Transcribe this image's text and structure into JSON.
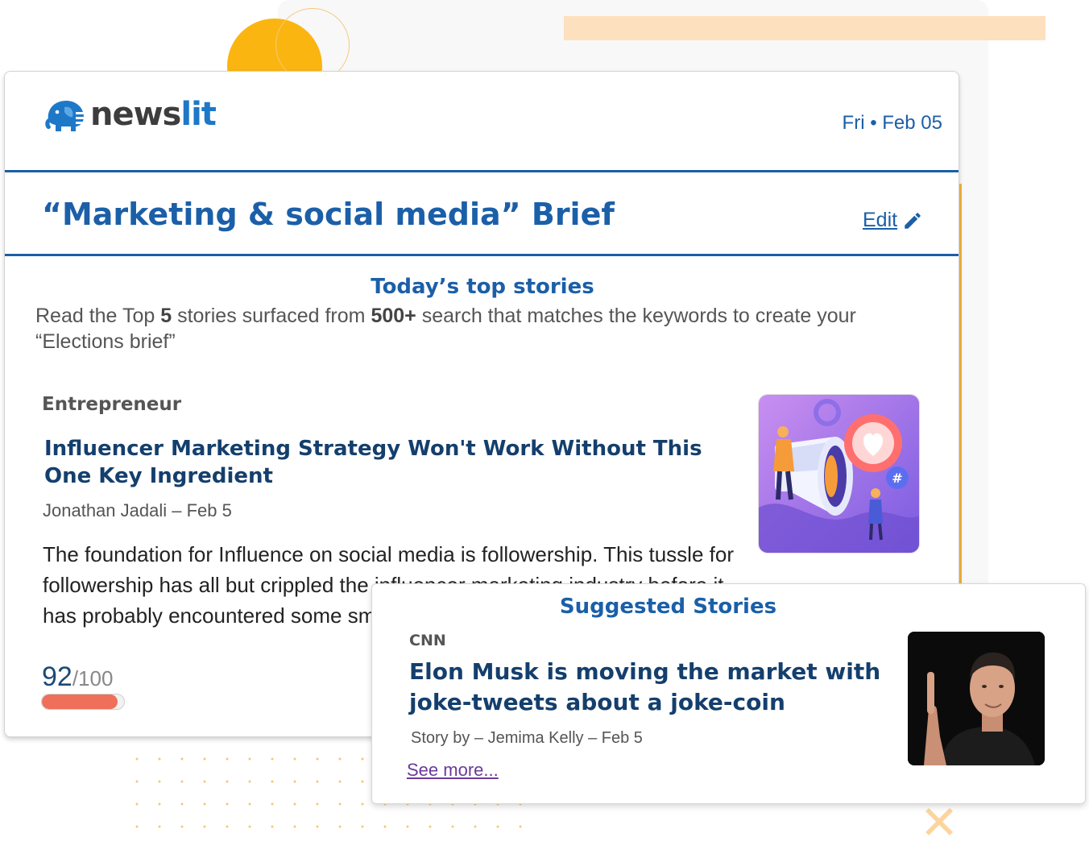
{
  "brand": {
    "name_part1": "news",
    "name_part2": "lit",
    "primary_color": "#1b5fa8",
    "accent_color": "#fbb511"
  },
  "header": {
    "date": "Fri • Feb 05"
  },
  "brief": {
    "title": "“Marketing & social media” Brief",
    "edit_label": "Edit"
  },
  "top_stories": {
    "heading": "Today’s top stories",
    "intro_part1": "Read the Top ",
    "intro_count": "5",
    "intro_part2": " stories surfaced from ",
    "intro_search": "500+",
    "intro_part3": " search that matches the keywords to create your “Elections  brief”"
  },
  "story": {
    "source": "Entrepreneur",
    "headline": "Influencer Marketing Strategy Won't Work Without This One Key Ingredient",
    "byline": "Jonathan Jadali – Feb 5",
    "summary": "The foundation for Influence on social media is followership. This tussle for followership has all but crippled the influencer marketing industry before it has probably encountered some sm",
    "score": "92",
    "score_max": "/100",
    "score_fraction": 0.92,
    "image_icon": "megaphone-social-illustration"
  },
  "suggested": {
    "heading": "Suggested Stories",
    "source": "CNN",
    "headline": "Elon Musk is moving the market with joke-tweets about a joke-coin",
    "byline": "Story by – Jemima Kelly – Feb 5",
    "see_more": "See more...",
    "image_icon": "person-portrait-photo"
  }
}
